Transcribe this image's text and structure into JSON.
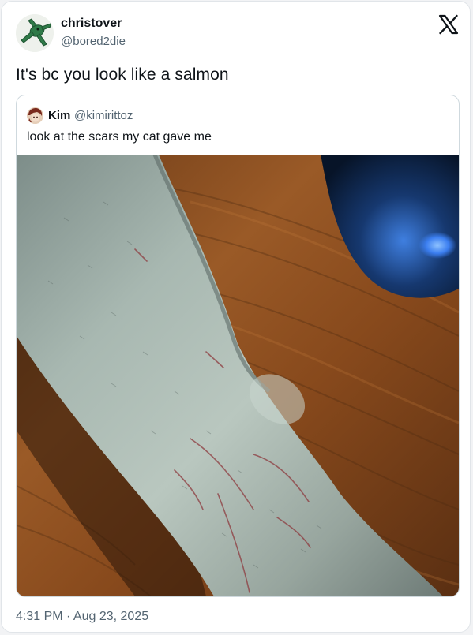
{
  "tweet": {
    "display_name": "christover",
    "handle": "@bored2die",
    "text": "It's bc you look like a salmon",
    "timestamp": "4:31 PM · Aug 23, 2025",
    "avatar_icon": "avatar-green-plush-icon",
    "platform_icon": "x-logo-icon"
  },
  "quoted": {
    "display_name": "Kim",
    "handle": "@kimirittoz",
    "text": "look at the scars my cat gave me",
    "avatar_icon": "avatar-anime-character-icon",
    "image_description_icon": "photo-of-arm-on-wooden-table"
  },
  "colors": {
    "text_primary": "#0f1419",
    "text_secondary": "#536471",
    "border": "#cfd9de",
    "wood": "#8a4f22",
    "skin": "#a9b8b0"
  }
}
